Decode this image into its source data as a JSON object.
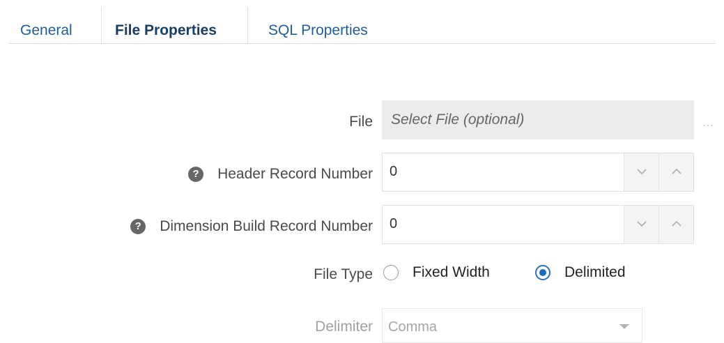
{
  "tabs": [
    {
      "label": "General",
      "active": false
    },
    {
      "label": "File Properties",
      "active": true
    },
    {
      "label": "SQL Properties",
      "active": false
    }
  ],
  "form": {
    "file": {
      "label": "File",
      "placeholder": "Select File (optional)",
      "browse_label": "…"
    },
    "header_record": {
      "label": "Header Record Number",
      "value": "0",
      "help": "?"
    },
    "dim_build_record": {
      "label": "Dimension Build Record Number",
      "value": "0",
      "help": "?"
    },
    "file_type": {
      "label": "File Type",
      "options": [
        "Fixed Width",
        "Delimited"
      ],
      "selected": "Delimited"
    },
    "delimiter": {
      "label": "Delimiter",
      "value": "Comma",
      "disabled": true
    }
  },
  "colors": {
    "accent": "#1a6bbf",
    "tab_text": "#1f5c99",
    "active_tab": "#1a3e66"
  }
}
